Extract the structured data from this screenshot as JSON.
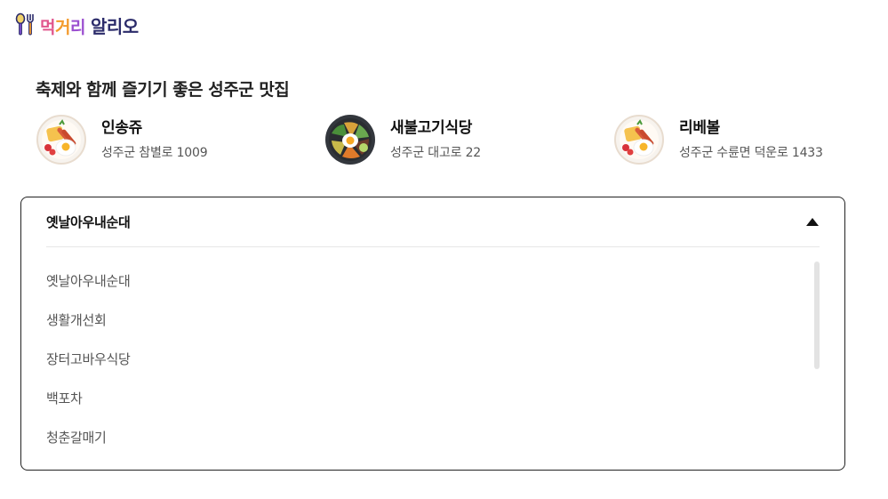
{
  "brand": {
    "logo_part1": "먹",
    "logo_part2": "거",
    "logo_part3": "리",
    "logo_part4": "알리오",
    "colors": {
      "pink": "#e0548c",
      "orange": "#f39a2b",
      "purple": "#9b4fd0",
      "navy": "#2b2b6a"
    }
  },
  "section_title": "축제와 함께 즐기기 좋은 성주군 맛집",
  "restaurants": [
    {
      "name": "인송쥬",
      "address": "성주군 참별로 1009",
      "image": "breakfast-plate-icon"
    },
    {
      "name": "새불고기식당",
      "address": "성주군 대고로 22",
      "image": "bibimbap-bowl-icon"
    },
    {
      "name": "리베볼",
      "address": "성주군 수륜면 덕운로 1433",
      "image": "breakfast-plate-icon"
    }
  ],
  "dropdown": {
    "selected": "옛날아우내순대",
    "expanded": true,
    "options": [
      "옛날아우내순대",
      "생활개선회",
      "장터고바우식당",
      "백포차",
      "청춘갈매기"
    ]
  }
}
